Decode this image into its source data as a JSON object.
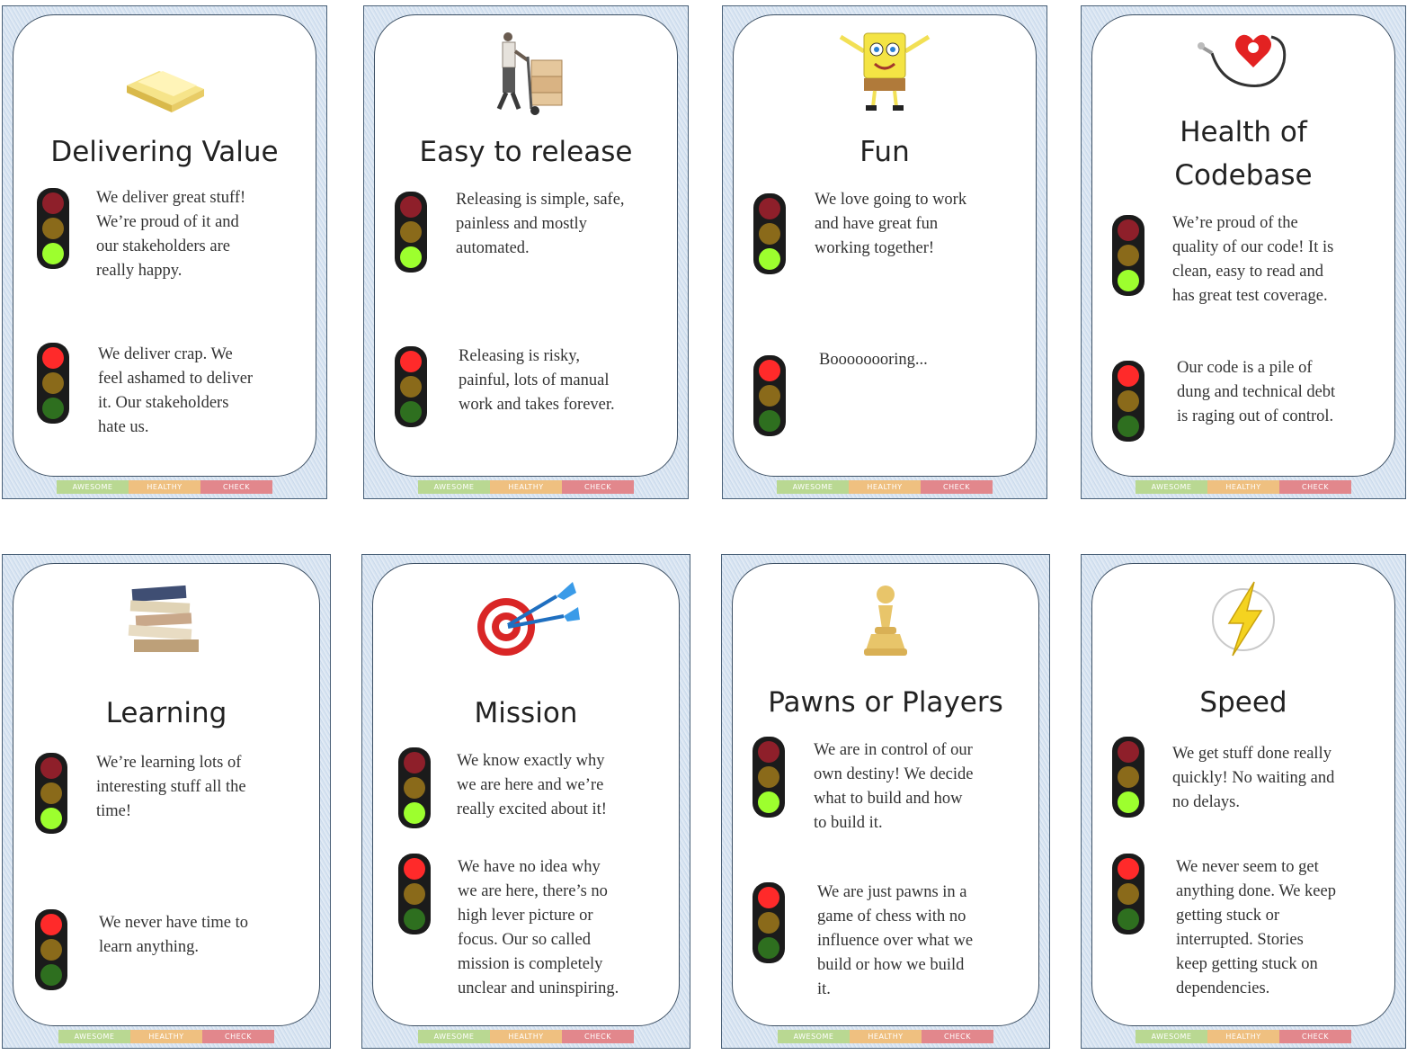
{
  "colors": {
    "card_border": "#4a6178",
    "card_texture": "#c5d6ea",
    "red_lit": "#ff2a2a",
    "amber_lit": "#e0b020",
    "green_lit": "#9dff2e",
    "red_dim": "#8e1f2a",
    "amber_dim": "#8a6a1a",
    "green_dim": "#2e6f1f",
    "footer_green": "#b9d892",
    "footer_amber": "#efc080",
    "footer_red": "#e2878c"
  },
  "footer": [
    "AWESOME",
    "HEALTHY",
    "CHECK"
  ],
  "cards": [
    {
      "icon": "gold-bar-icon",
      "title": "Delivering Value",
      "good": "We deliver great stuff!\nWe’re proud of it and\nour stakeholders are\nreally happy.",
      "bad": "We deliver crap. We\nfeel ashamed to deliver\nit. Our stakeholders\nhate us."
    },
    {
      "icon": "delivery-hand-truck-icon",
      "title": "Easy to release",
      "good": "Releasing is simple, safe,\npainless and mostly\nautomated.",
      "bad": "Releasing is risky,\npainful, lots of manual\nwork and takes forever."
    },
    {
      "icon": "spongebob-icon",
      "title": "Fun",
      "good": "We love going to work\nand have great fun\nworking together!",
      "bad": "Boooooooring..."
    },
    {
      "icon": "heart-stethoscope-icon",
      "title": "Health of Codebase",
      "good": "We’re proud of the\nquality of our code! It is\nclean, easy to read and\nhas great test coverage.",
      "bad": "Our code is a pile of\ndung and technical debt\nis raging out of control."
    },
    {
      "icon": "book-stack-icon",
      "title": "Learning",
      "good": "We’re learning lots of\ninteresting stuff all the\ntime!",
      "bad": "We never have time to\nlearn anything."
    },
    {
      "icon": "dartboard-icon",
      "title": "Mission",
      "good": "We know exactly why\nwe are here and we’re\nreally excited about it!",
      "bad": "We have no idea why\nwe are here, there’s no\nhigh lever picture or\nfocus. Our so called\nmission is completely\nunclear and uninspiring."
    },
    {
      "icon": "chess-pawn-icon",
      "title": "Pawns or Players",
      "good": "We are in control of our\nown destiny! We decide\nwhat to build and how\nto build it.",
      "bad": "We are just pawns in a\ngame of chess with no\ninfluence over what we\nbuild or how we build\nit."
    },
    {
      "icon": "lightning-bolt-icon",
      "title": "Speed",
      "good": "We get stuff done really\nquickly! No waiting and\nno delays.",
      "bad": "We never seem to get\nanything done. We keep\ngetting stuck or\ninterrupted. Stories\nkeep getting stuck on\ndependencies."
    }
  ]
}
